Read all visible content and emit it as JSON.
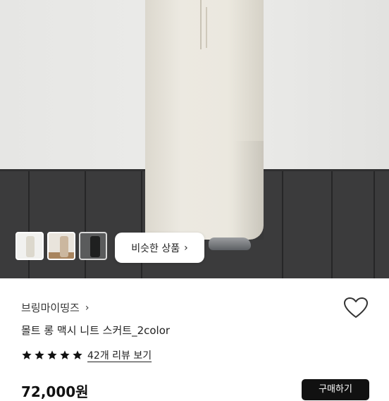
{
  "gallery": {
    "similar_button_label": "비슷한 상품",
    "thumbnails": [
      "white-skirt",
      "beige-skirt",
      "black-skirt"
    ]
  },
  "product": {
    "seller": "브링마이띵즈",
    "title": "몰트 롱 맥시 니트 스커트_2color",
    "rating_stars": 5,
    "review_link": "42개 리뷰 보기",
    "price": "72,000원",
    "buy_label": "구매하기"
  },
  "colors": {
    "accent": "#111111",
    "star": "#111111"
  }
}
